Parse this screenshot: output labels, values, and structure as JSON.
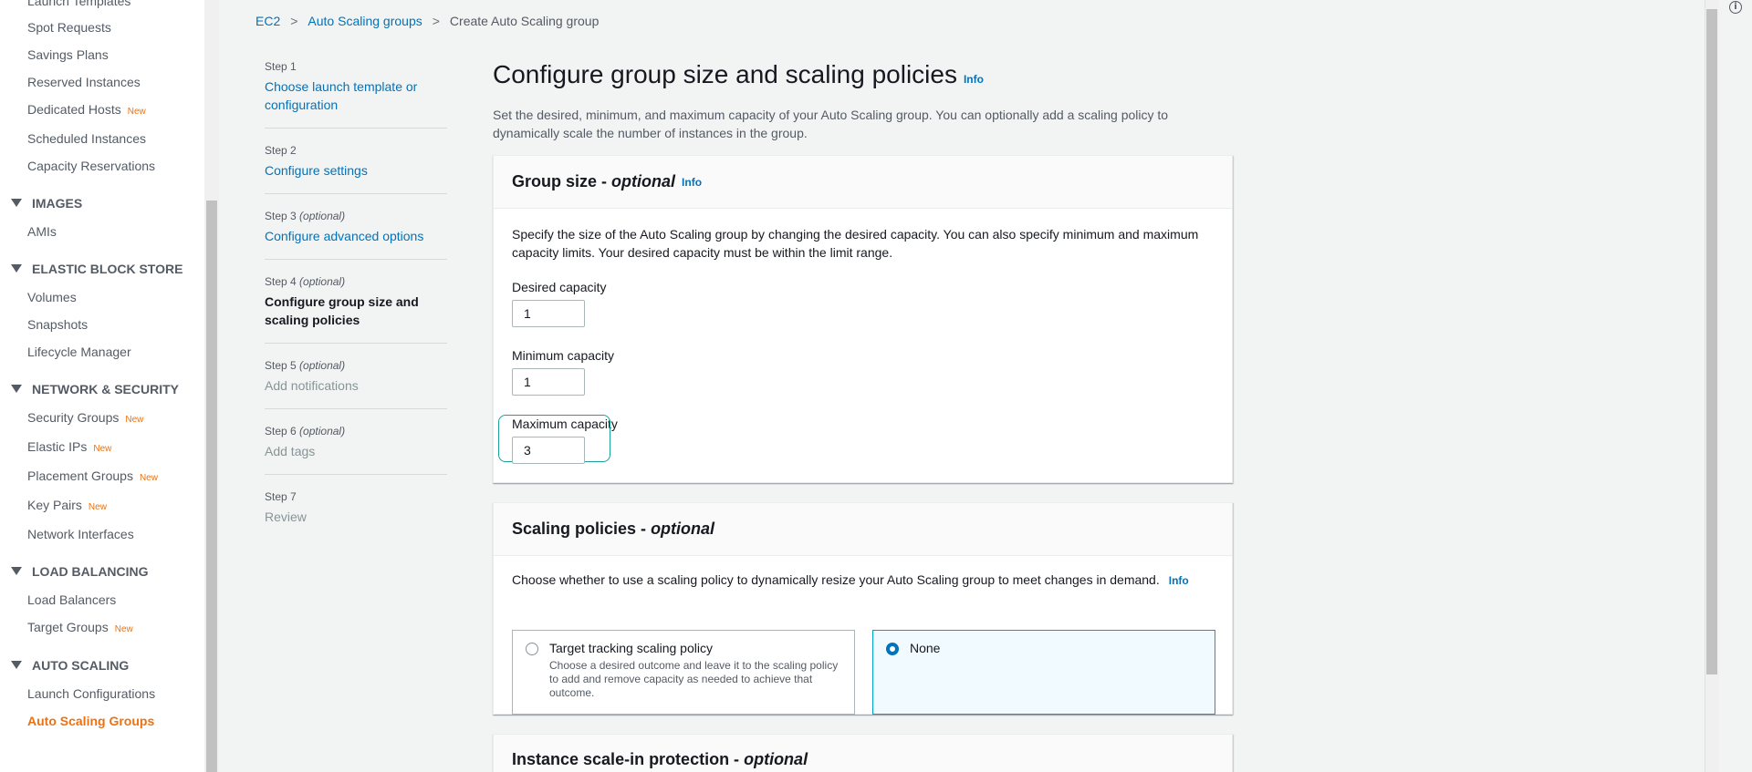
{
  "sidebar": {
    "items": [
      {
        "label": "Launch Templates",
        "new": ""
      },
      {
        "label": "Spot Requests",
        "new": ""
      },
      {
        "label": "Savings Plans",
        "new": ""
      },
      {
        "label": "Reserved Instances",
        "new": ""
      },
      {
        "label": "Dedicated Hosts",
        "new": "New"
      },
      {
        "label": "Scheduled Instances",
        "new": ""
      },
      {
        "label": "Capacity Reservations",
        "new": ""
      }
    ],
    "sections": {
      "images": {
        "title": "IMAGES",
        "items": [
          {
            "label": "AMIs"
          }
        ]
      },
      "ebs": {
        "title": "ELASTIC BLOCK STORE",
        "items": [
          {
            "label": "Volumes"
          },
          {
            "label": "Snapshots"
          },
          {
            "label": "Lifecycle Manager"
          }
        ]
      },
      "network": {
        "title": "NETWORK & SECURITY",
        "items": [
          {
            "label": "Security Groups",
            "new": "New"
          },
          {
            "label": "Elastic IPs",
            "new": "New"
          },
          {
            "label": "Placement Groups",
            "new": "New"
          },
          {
            "label": "Key Pairs",
            "new": "New"
          },
          {
            "label": "Network Interfaces",
            "new": ""
          }
        ]
      },
      "lb": {
        "title": "LOAD BALANCING",
        "items": [
          {
            "label": "Load Balancers",
            "new": ""
          },
          {
            "label": "Target Groups",
            "new": "New"
          }
        ]
      },
      "as": {
        "title": "AUTO SCALING",
        "items": [
          {
            "label": "Launch Configurations"
          },
          {
            "label": "Auto Scaling Groups"
          }
        ]
      }
    }
  },
  "breadcrumb": {
    "items": [
      "EC2",
      "Auto Scaling groups",
      "Create Auto Scaling group"
    ]
  },
  "steps": [
    {
      "num": "Step 1",
      "optional": "",
      "title": "Choose launch template or configuration",
      "state": "done"
    },
    {
      "num": "Step 2",
      "optional": "",
      "title": "Configure settings",
      "state": "done"
    },
    {
      "num": "Step 3",
      "optional": "(optional)",
      "title": "Configure advanced options",
      "state": "done"
    },
    {
      "num": "Step 4",
      "optional": "(optional)",
      "title": "Configure group size and scaling policies",
      "state": "current"
    },
    {
      "num": "Step 5",
      "optional": "(optional)",
      "title": "Add notifications",
      "state": "disabled"
    },
    {
      "num": "Step 6",
      "optional": "(optional)",
      "title": "Add tags",
      "state": "disabled"
    },
    {
      "num": "Step 7",
      "optional": "",
      "title": "Review",
      "state": "disabled"
    }
  ],
  "page": {
    "title": "Configure group size and scaling policies",
    "info": "Info",
    "description": "Set the desired, minimum, and maximum capacity of your Auto Scaling group. You can optionally add a scaling policy to dynamically scale the number of instances in the group."
  },
  "group_size": {
    "title": "Group size - ",
    "title_optional": "optional",
    "info": "Info",
    "description": "Specify the size of the Auto Scaling group by changing the desired capacity. You can also specify minimum and maximum capacity limits. Your desired capacity must be within the limit range.",
    "desired_label": "Desired capacity",
    "desired_value": "1",
    "min_label": "Minimum capacity",
    "min_value": "1",
    "max_label": "Maximum capacity",
    "max_value": "3"
  },
  "scaling": {
    "title": "Scaling policies - ",
    "title_optional": "optional",
    "description": "Choose whether to use a scaling policy to dynamically resize your Auto Scaling group to meet changes in demand.",
    "info": "Info",
    "option_target_title": "Target tracking scaling policy",
    "option_target_desc": "Choose a desired outcome and leave it to the scaling policy to add and remove capacity as needed to achieve that outcome.",
    "option_none_title": "None",
    "selected": "None"
  },
  "protection": {
    "title": "Instance scale-in protection - ",
    "title_optional": "optional"
  },
  "colors": {
    "accent": "#0073bb",
    "orange": "#ec7211",
    "focus": "#1aa29a"
  }
}
